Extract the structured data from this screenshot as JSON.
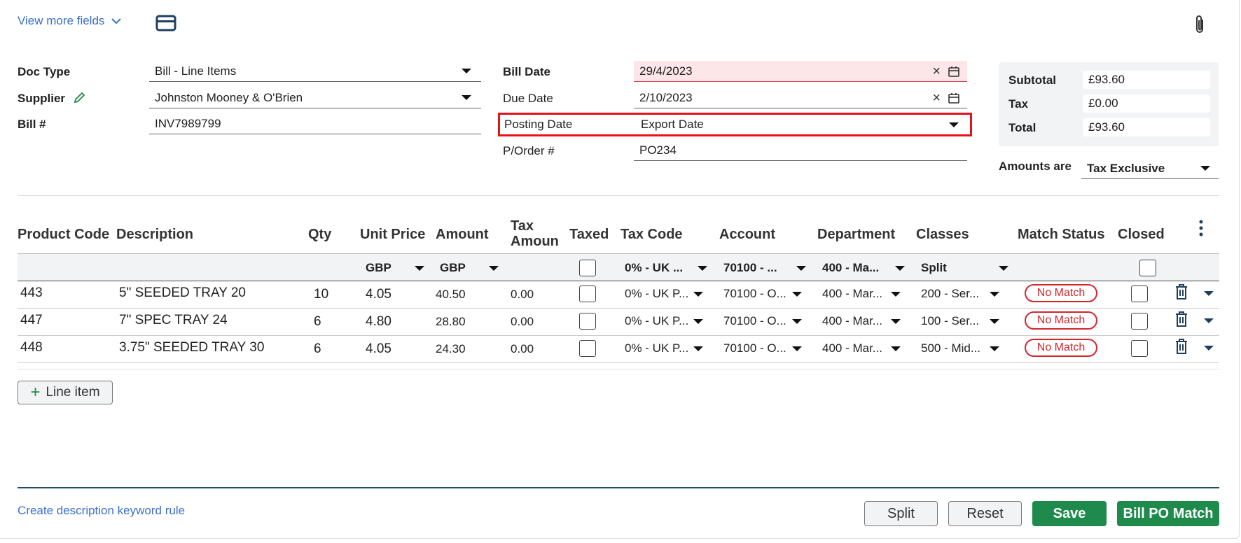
{
  "top": {
    "view_more_label": "View more fields"
  },
  "header": {
    "doc_type": {
      "label": "Doc Type",
      "value": "Bill - Line Items"
    },
    "supplier": {
      "label": "Supplier",
      "value": "Johnston Mooney & O'Brien"
    },
    "bill_no": {
      "label": "Bill #",
      "value": "INV7989799"
    },
    "bill_date": {
      "label": "Bill Date",
      "value": "29/4/2023"
    },
    "due_date": {
      "label": "Due Date",
      "value": "2/10/2023"
    },
    "posting_date": {
      "label": "Posting Date",
      "value": "Export Date"
    },
    "po_no": {
      "label": "P/Order #",
      "value": "PO234"
    }
  },
  "totals": {
    "subtotal": {
      "label": "Subtotal",
      "value": "£93.60"
    },
    "tax": {
      "label": "Tax",
      "value": "£0.00"
    },
    "total": {
      "label": "Total",
      "value": "£93.60"
    },
    "amounts_are": {
      "label": "Amounts are",
      "value": "Tax Exclusive"
    }
  },
  "table": {
    "headers": {
      "product_code": "Product Code",
      "description": "Description",
      "qty": "Qty",
      "unit_price": "Unit Price",
      "amount": "Amount",
      "tax_amount_1": "Tax",
      "tax_amount_2": "Amoun",
      "taxed": "Taxed",
      "tax_code": "Tax Code",
      "account": "Account",
      "department": "Department",
      "classes": "Classes",
      "match_status": "Match Status",
      "closed": "Closed"
    },
    "filters": {
      "unit_price_currency": "GBP",
      "amount_currency": "GBP",
      "tax_code": "0% - UK ...",
      "account": "70100 - ...",
      "department": "400 - Ma...",
      "classes": "Split"
    },
    "rows": [
      {
        "code": "443",
        "description": "5\" SEEDED TRAY 20",
        "qty": "10",
        "unit_price": "4.05",
        "amount": "40.50",
        "tax_amount": "0.00",
        "tax_code": "0% - UK P...",
        "account": "70100 - O...",
        "department": "400 - Mar...",
        "classes": "200 - Ser...",
        "match_status": "No Match"
      },
      {
        "code": "447",
        "description": "7\" SPEC TRAY 24",
        "qty": "6",
        "unit_price": "4.80",
        "amount": "28.80",
        "tax_amount": "0.00",
        "tax_code": "0% - UK P...",
        "account": "70100 - O...",
        "department": "400 - Mar...",
        "classes": "100 - Ser...",
        "match_status": "No Match"
      },
      {
        "code": "448",
        "description": "3.75\" SEEDED TRAY 30",
        "qty": "6",
        "unit_price": "4.05",
        "amount": "24.30",
        "tax_amount": "0.00",
        "tax_code": "0% - UK P...",
        "account": "70100 - O...",
        "department": "400 - Mar...",
        "classes": "500 - Mid...",
        "match_status": "No Match"
      }
    ]
  },
  "footer": {
    "add_line_label": "Line item",
    "keyword_rule_label": "Create description keyword rule",
    "split_label": "Split",
    "reset_label": "Reset",
    "save_label": "Save",
    "bill_po_match_label": "Bill PO Match"
  },
  "colors": {
    "accent_green": "#1e8a4c",
    "link_blue": "#3b6fc9",
    "error_red": "#d2262f",
    "highlight_red": "#e8121a"
  }
}
